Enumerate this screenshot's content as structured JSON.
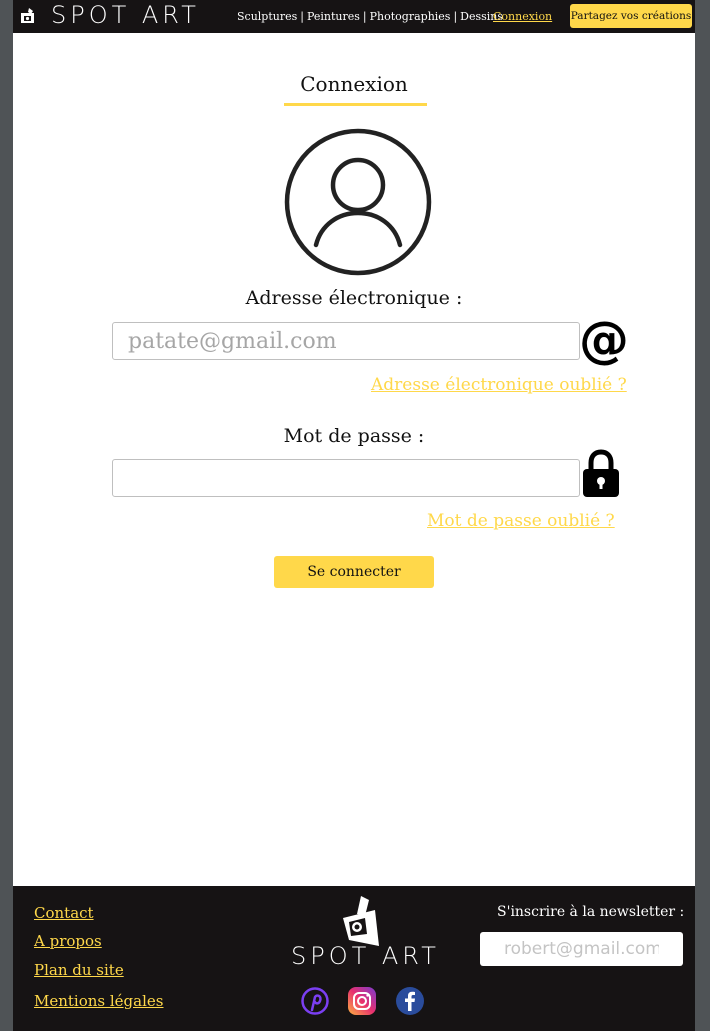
{
  "header": {
    "logo_text": "SPOT ART",
    "nav": {
      "sculptures": "Sculptures",
      "peintures": "Peintures",
      "photographies": "Photographies",
      "dessins": "Dessins",
      "separator": "|"
    },
    "login_link": "Connexion",
    "share_button": "Partagez vos créations"
  },
  "main": {
    "title": "Connexion",
    "email": {
      "label": "Adresse électronique :",
      "value": "",
      "placeholder": "patate@gmail.com",
      "icon": "at-sign-icon",
      "forgot": "Adresse électronique oublié ?"
    },
    "password": {
      "label": "Mot de passe :",
      "value": "",
      "placeholder": "",
      "icon": "lock-icon",
      "forgot": "Mot de passe oublié ?"
    },
    "submit": "Se connecter"
  },
  "footer": {
    "links": [
      "Contact",
      "A propos",
      "Plan du site",
      "Mentions légales"
    ],
    "logo_text": "SPOT ART",
    "social_icons": [
      "pinterest-icon",
      "instagram-icon",
      "facebook-icon"
    ],
    "newsletter": {
      "label": "S'inscrire à la newsletter :",
      "placeholder": "robert@gmail.com"
    }
  },
  "colors": {
    "accent": "#ffd84a",
    "dark": "#161314",
    "frame": "#4f5356"
  }
}
